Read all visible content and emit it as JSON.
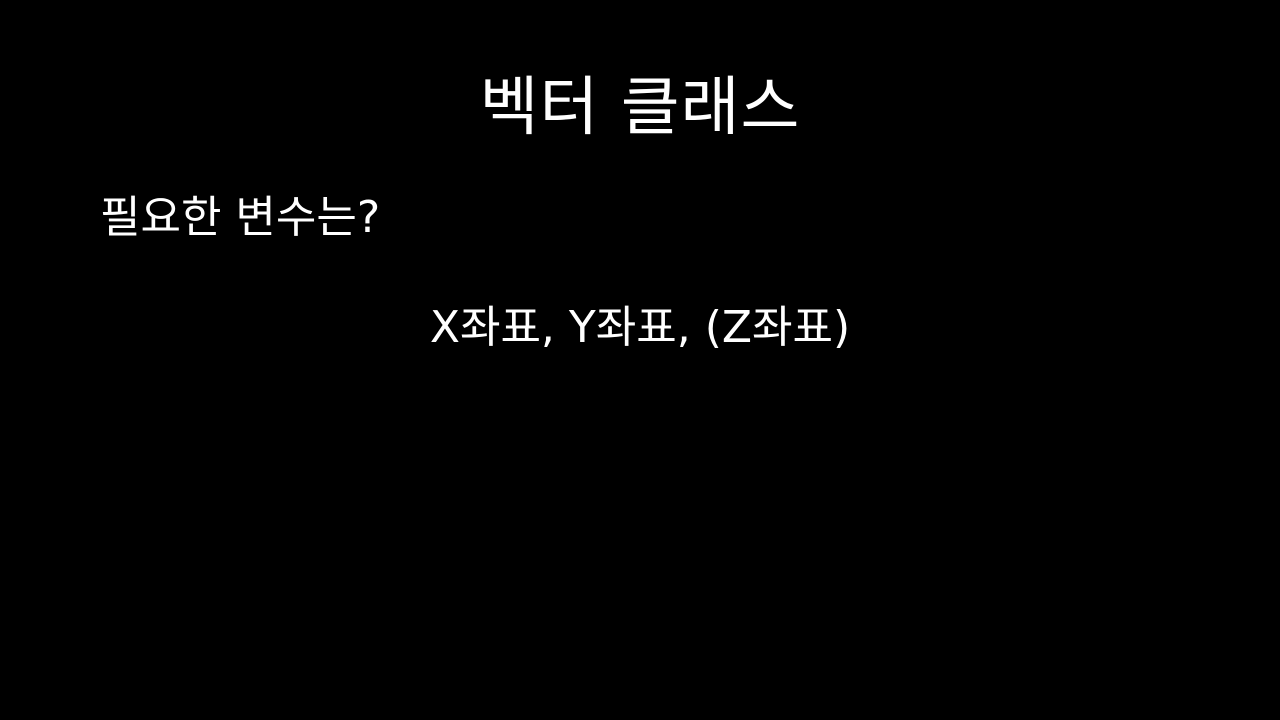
{
  "slide": {
    "title": "벡터 클래스",
    "question": "필요한 변수는?",
    "answer": "X좌표, Y좌표, (Z좌표)"
  },
  "colors": {
    "background": "#000000",
    "text": "#ffffff"
  }
}
